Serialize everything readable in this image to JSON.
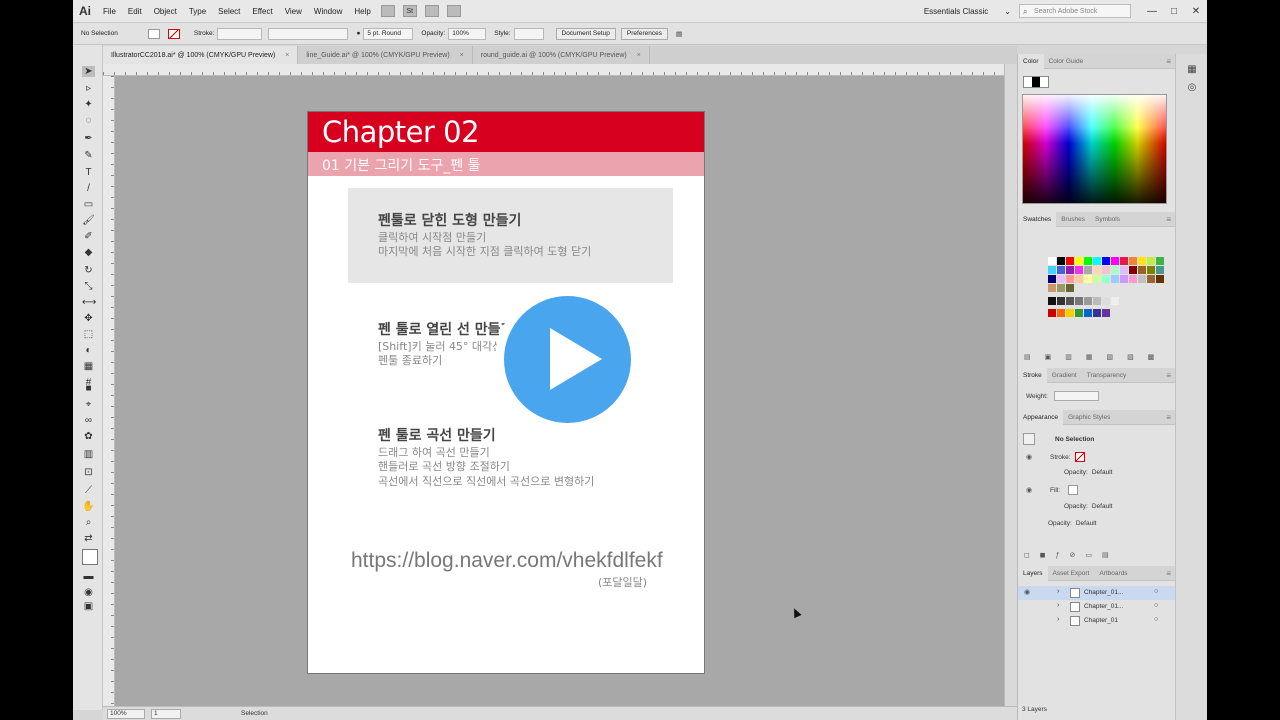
{
  "app": {
    "logo": "Ai",
    "menu": [
      "File",
      "Edit",
      "Object",
      "Type",
      "Select",
      "Effect",
      "View",
      "Window",
      "Help"
    ],
    "menubar_icons": [
      "St"
    ],
    "workspace": "Essentials Classic",
    "search_placeholder": "Search Adobe Stock",
    "window_buttons": [
      "—",
      "□",
      "✕"
    ]
  },
  "control_bar": {
    "selection": "No Selection",
    "stroke_label": "Stroke:",
    "brush": "5 pt. Round",
    "opacity_label": "Opacity:",
    "opacity_value": "100%",
    "style_label": "Style:",
    "document_setup": "Document Setup",
    "preferences": "Preferences"
  },
  "tabs": [
    {
      "label": "IllustratorCC2018.ai* @ 100% (CMYK/GPU Preview)",
      "active": true
    },
    {
      "label": "line_Guide.ai* @ 100% (CMYK/GPU Preview)",
      "active": false
    },
    {
      "label": "round_guide.ai @ 100% (CMYK/GPU Preview)",
      "active": false
    }
  ],
  "artboard": {
    "chapter_title": "Chapter 02",
    "chapter_sub": "01 기본 그리기 도구_펜 툴",
    "section1": {
      "title": "펜툴로 닫힌 도형 만들기",
      "lines": [
        "클릭하여 시작점 만들기",
        "마지막에 처음 시작한 지점 클릭하여 도형 닫기"
      ]
    },
    "section2": {
      "title": "펜 툴로 열린 선 만들기",
      "lines": [
        "[Shift]키 눌러 45° 대각선 만들기",
        "펜툴 종료하기"
      ]
    },
    "section3": {
      "title": "펜 툴로 곡선 만들기",
      "lines": [
        "드래그 하여 곡선 만들기",
        "핸들러로 곡선 방향 조절하기",
        "곡선에서 직선으로 직선에서 곡선으로 변형하기"
      ]
    },
    "url": "https://blog.naver.com/vhekfdlfekf",
    "alias": "(포달일달)"
  },
  "status": {
    "zoom": "100%",
    "page": "1",
    "tool": "Selection"
  },
  "panels": {
    "color_tabs": [
      "Color",
      "Color Guide"
    ],
    "swatch_tabs": [
      "Swatches",
      "Brushes",
      "Symbols"
    ],
    "stroke_tabs": [
      "Stroke",
      "Gradient",
      "Transparency"
    ],
    "weight_label": "Weight:",
    "appearance_tabs": [
      "Appearance",
      "Graphic Styles"
    ],
    "appearance": {
      "title": "No Selection",
      "stroke_label": "Stroke:",
      "opacity1_label": "Opacity:",
      "opacity1_value": "Default",
      "fill_label": "Fill:",
      "opacity2_label": "Opacity:",
      "opacity2_value": "Default",
      "opacity3_label": "Opacity:",
      "opacity3_value": "Default"
    },
    "layers_tabs": [
      "Layers",
      "Asset Export",
      "Artboards"
    ],
    "layers": [
      "Chapter_01...",
      "Chapter_01...",
      "Chapter_01"
    ],
    "layers_count": "3 Layers"
  },
  "colors": {
    "chapter_red": "#d7001e",
    "chapter_pink": "#eba4ae",
    "play_blue": "#4aa5ef"
  }
}
